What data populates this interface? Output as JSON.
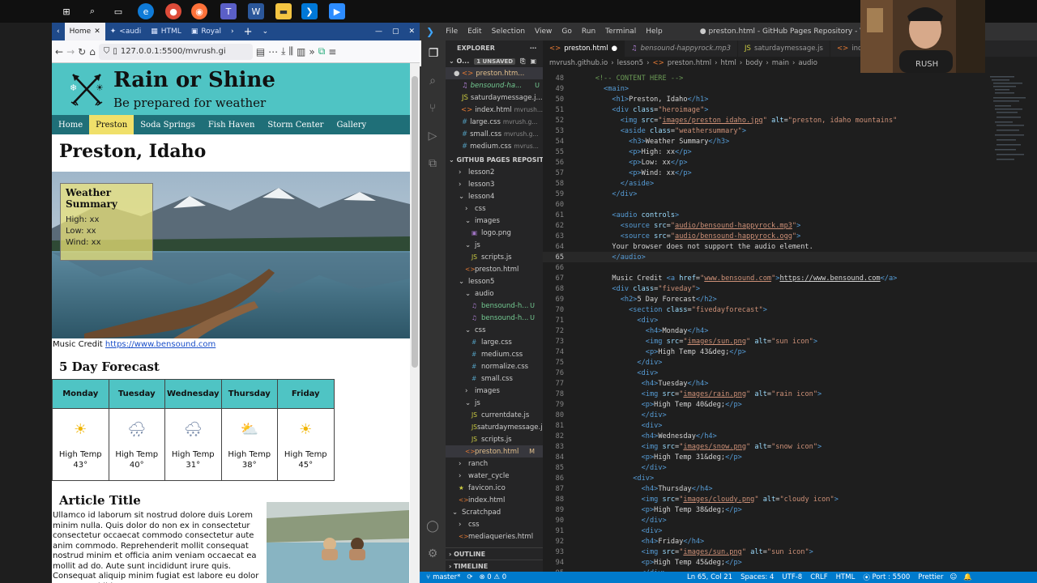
{
  "taskbar": {
    "icons": [
      "windows-icon",
      "search-icon",
      "task-view-icon",
      "edge-icon",
      "chrome-icon",
      "firefox-icon",
      "teams-icon",
      "word-icon",
      "file-explorer-icon",
      "vscode-icon",
      "zoom-icon"
    ]
  },
  "browser": {
    "tabs": [
      {
        "label": "Home",
        "active": true
      },
      {
        "label": "<audi"
      },
      {
        "label": "HTML"
      },
      {
        "label": "Royal"
      }
    ],
    "url": "127.0.0.1:5500/mvrush.gi",
    "page": {
      "site_title": "Rain or Shine",
      "tagline": "Be prepared for weather",
      "nav": [
        "Home",
        "Preston",
        "Soda Springs",
        "Fish Haven",
        "Storm Center",
        "Gallery"
      ],
      "active_nav": "Preston",
      "h1": "Preston, Idaho",
      "weather_summary": {
        "title": "Weather Summary",
        "high": "High: xx",
        "low": "Low: xx",
        "wind": "Wind: xx"
      },
      "credit_label": "Music Credit",
      "credit_link": "https://www.bensound.com",
      "forecast_title": "5 Day Forecast",
      "forecast": [
        {
          "day": "Monday",
          "icon": "sun-icon",
          "glyph": "☀",
          "temp": "High Temp 43°"
        },
        {
          "day": "Tuesday",
          "icon": "rain-icon",
          "glyph": "🌧",
          "temp": "High Temp 40°"
        },
        {
          "day": "Wednesday",
          "icon": "snow-icon",
          "glyph": "🌨",
          "temp": "High Temp 31°"
        },
        {
          "day": "Thursday",
          "icon": "cloudy-icon",
          "glyph": "⛅",
          "temp": "High Temp 38°"
        },
        {
          "day": "Friday",
          "icon": "sun-icon",
          "glyph": "☀",
          "temp": "High Temp 45°"
        }
      ],
      "article_title": "Article Title",
      "article_text": "Ullamco id laborum sit nostrud dolore duis Lorem minim nulla. Quis dolor do non ex in consectetur consectetur occaecat commodo consectetur aute anim commodo. Reprehenderit mollit consequat nostrud minim et officia anim veniam occaecat ea mollit ad do. Aute sunt incididunt irure quis. Consequat aliquip minim fugiat est labore eu dolor magna. Incididunt"
    }
  },
  "vscode": {
    "menu": [
      "File",
      "Edit",
      "Selection",
      "View",
      "Go",
      "Run",
      "Terminal",
      "Help"
    ],
    "window_title": "● preston.html - GitHub Pages Repository - Visual Studio Coc",
    "explorer_label": "EXPLORER",
    "open_editors_label": "O...",
    "unsaved_badge": "1 UNSAVED",
    "open_editors": [
      {
        "name": "preston.htm...",
        "dirty": true
      },
      {
        "name": "bensound-ha...",
        "badge": "U"
      },
      {
        "name": "saturdaymessage.j..."
      },
      {
        "name": "index.html",
        "path": "mvrush..."
      },
      {
        "name": "large.css",
        "path": "mvrush.g..."
      },
      {
        "name": "small.css",
        "path": "mvrush.g..."
      },
      {
        "name": "medium.css",
        "path": "mvrus..."
      }
    ],
    "repo_label": "GITHUB PAGES REPOSITORY",
    "tree": [
      {
        "name": "lesson2",
        "indent": 1,
        "type": "folder"
      },
      {
        "name": "lesson3",
        "indent": 1,
        "type": "folder"
      },
      {
        "name": "lesson4",
        "indent": 1,
        "type": "folder-open"
      },
      {
        "name": "css",
        "indent": 2,
        "type": "folder"
      },
      {
        "name": "images",
        "indent": 2,
        "type": "folder-open"
      },
      {
        "name": "logo.png",
        "indent": 3,
        "type": "file"
      },
      {
        "name": "js",
        "indent": 2,
        "type": "folder-open"
      },
      {
        "name": "scripts.js",
        "indent": 3,
        "type": "file"
      },
      {
        "name": "preston.html",
        "indent": 2,
        "type": "file"
      },
      {
        "name": "lesson5",
        "indent": 1,
        "type": "folder-open"
      },
      {
        "name": "audio",
        "indent": 2,
        "type": "folder-open"
      },
      {
        "name": "bensound-h...",
        "indent": 3,
        "type": "file",
        "badge": "U"
      },
      {
        "name": "bensound-h...",
        "indent": 3,
        "type": "file",
        "badge": "U"
      },
      {
        "name": "css",
        "indent": 2,
        "type": "folder-open"
      },
      {
        "name": "large.css",
        "indent": 3,
        "type": "file"
      },
      {
        "name": "medium.css",
        "indent": 3,
        "type": "file"
      },
      {
        "name": "normalize.css",
        "indent": 3,
        "type": "file"
      },
      {
        "name": "small.css",
        "indent": 3,
        "type": "file"
      },
      {
        "name": "images",
        "indent": 2,
        "type": "folder"
      },
      {
        "name": "js",
        "indent": 2,
        "type": "folder-open"
      },
      {
        "name": "currentdate.js",
        "indent": 3,
        "type": "file"
      },
      {
        "name": "saturdaymessage.js",
        "indent": 3,
        "type": "file"
      },
      {
        "name": "scripts.js",
        "indent": 3,
        "type": "file"
      },
      {
        "name": "preston.html",
        "indent": 2,
        "type": "file",
        "badge": "M",
        "selected": true
      },
      {
        "name": "ranch",
        "indent": 1,
        "type": "folder"
      },
      {
        "name": "water_cycle",
        "indent": 1,
        "type": "folder"
      },
      {
        "name": "favicon.ico",
        "indent": 1,
        "type": "file"
      },
      {
        "name": "index.html",
        "indent": 1,
        "type": "file"
      },
      {
        "name": "Scratchpad",
        "indent": 0,
        "type": "folder-open"
      },
      {
        "name": "css",
        "indent": 1,
        "type": "folder"
      },
      {
        "name": "mediaqueries.html",
        "indent": 1,
        "type": "file"
      }
    ],
    "outline_label": "OUTLINE",
    "timeline_label": "TIMELINE",
    "tabs": [
      {
        "label": "preston.html",
        "active": true,
        "dirty": true
      },
      {
        "label": "bensound-happyrock.mp3"
      },
      {
        "label": "saturdaymessage.js"
      },
      {
        "label": "index"
      }
    ],
    "breadcrumb": [
      "mvrush.github.io",
      "lesson5",
      "preston.html",
      "html",
      "body",
      "main",
      "audio"
    ],
    "code_lines": [
      {
        "n": "48",
        "html": "<span class='cm'>    &lt;!-- CONTENT HERE --&gt;</span>"
      },
      {
        "n": "49",
        "html": "<span class='tg'>      &lt;main&gt;</span>"
      },
      {
        "n": "50",
        "html": "<span class='tg'>        &lt;h1&gt;</span><span class='tx'>Preston, Idaho</span><span class='tg'>&lt;/h1&gt;</span>"
      },
      {
        "n": "51",
        "html": "<span class='tg'>        &lt;div </span><span class='at'>class</span><span class='tx'>=</span><span class='st'>\"heroimage\"</span><span class='tg'>&gt;</span>"
      },
      {
        "n": "52",
        "html": "<span class='tg'>          &lt;img </span><span class='at'>src</span><span class='tx'>=</span><span class='st'>\"<span class='ul'>images/preston_idaho.jpg</span>\"</span><span class='at'> alt</span><span class='tx'>=</span><span class='st'>\"preston, idaho mountains\"</span>"
      },
      {
        "n": "53",
        "html": "<span class='tg'>          &lt;aside </span><span class='at'>class</span><span class='tx'>=</span><span class='st'>\"weathersummary\"</span><span class='tg'>&gt;</span>"
      },
      {
        "n": "54",
        "html": "<span class='tg'>            &lt;h3&gt;</span><span class='tx'>Weather Summary</span><span class='tg'>&lt;/h3&gt;</span>"
      },
      {
        "n": "55",
        "html": "<span class='tg'>            &lt;p&gt;</span><span class='tx'>High: xx</span><span class='tg'>&lt;/p&gt;</span>"
      },
      {
        "n": "56",
        "html": "<span class='tg'>            &lt;p&gt;</span><span class='tx'>Low: xx</span><span class='tg'>&lt;/p&gt;</span>"
      },
      {
        "n": "57",
        "html": "<span class='tg'>            &lt;p&gt;</span><span class='tx'>Wind: xx</span><span class='tg'>&lt;/p&gt;</span>"
      },
      {
        "n": "58",
        "html": "<span class='tg'>          &lt;/aside&gt;</span>"
      },
      {
        "n": "59",
        "html": "<span class='tg'>        &lt;/div&gt;</span>"
      },
      {
        "n": "60",
        "html": ""
      },
      {
        "n": "61",
        "html": "<span class='tg'>        &lt;audio </span><span class='at'>controls</span><span class='tg'>&gt;</span>"
      },
      {
        "n": "62",
        "html": "<span class='tg'>          &lt;source </span><span class='at'>src</span><span class='tx'>=</span><span class='st'>\"<span class='ul'>audio/bensound-happyrock.mp3</span>\"</span><span class='tg'>&gt;</span>"
      },
      {
        "n": "63",
        "html": "<span class='tg'>          &lt;source </span><span class='at'>src</span><span class='tx'>=</span><span class='st'>\"<span class='ul'>audio/bensound-happyrock.ogg</span>\"</span><span class='tg'>&gt;</span>"
      },
      {
        "n": "64",
        "html": "<span class='tx'>        Your browser does not support the audio element.</span>"
      },
      {
        "n": "65",
        "html": "<span class='tg'>        &lt;/audio&gt;</span>",
        "cur": true
      },
      {
        "n": "66",
        "html": ""
      },
      {
        "n": "67",
        "html": "<span class='tx'>        Music Credit </span><span class='tg'>&lt;a </span><span class='at'>href</span><span class='tx'>=</span><span class='st'>\"<span class='ul'>www.bensound.com</span>\"</span><span class='tg'>&gt;</span><span class='tx ul'>https://www.bensound.com</span><span class='tg'>&lt;/a&gt;</span>"
      },
      {
        "n": "68",
        "html": "<span class='tg'>        &lt;div </span><span class='at'>class</span><span class='tx'>=</span><span class='st'>\"fiveday\"</span><span class='tg'>&gt;</span>"
      },
      {
        "n": "69",
        "html": "<span class='tg'>          &lt;h2&gt;</span><span class='tx'>5 Day Forecast</span><span class='tg'>&lt;/h2&gt;</span>"
      },
      {
        "n": "70",
        "html": "<span class='tg'>            &lt;section </span><span class='at'>class</span><span class='tx'>=</span><span class='st'>\"fivedayforecast\"</span><span class='tg'>&gt;</span>"
      },
      {
        "n": "71",
        "html": "<span class='tg'>              &lt;div&gt;</span>"
      },
      {
        "n": "72",
        "html": "<span class='tg'>                &lt;h4&gt;</span><span class='tx'>Monday</span><span class='tg'>&lt;/h4&gt;</span>"
      },
      {
        "n": "73",
        "html": "<span class='tg'>                &lt;img </span><span class='at'>src</span><span class='tx'>=</span><span class='st'>\"<span class='ul'>images/sun.png</span>\"</span><span class='at'> alt</span><span class='tx'>=</span><span class='st'>\"sun icon\"</span><span class='tg'>&gt;</span>"
      },
      {
        "n": "74",
        "html": "<span class='tg'>                &lt;p&gt;</span><span class='tx'>High Temp 43</span><span class='en'>&amp;deg;</span><span class='tg'>&lt;/p&gt;</span>"
      },
      {
        "n": "75",
        "html": "<span class='tg'>              &lt;/div&gt;</span>"
      },
      {
        "n": "76",
        "html": "<span class='tg'>              &lt;div&gt;</span>"
      },
      {
        "n": "77",
        "html": "<span class='tg'>               &lt;h4&gt;</span><span class='tx'>Tuesday</span><span class='tg'>&lt;/h4&gt;</span>"
      },
      {
        "n": "78",
        "html": "<span class='tg'>               &lt;img </span><span class='at'>src</span><span class='tx'>=</span><span class='st'>\"<span class='ul'>images/rain.png</span>\"</span><span class='at'> alt</span><span class='tx'>=</span><span class='st'>\"rain icon\"</span><span class='tg'>&gt;</span>"
      },
      {
        "n": "79",
        "html": "<span class='tg'>               &lt;p&gt;</span><span class='tx'>High Temp 40</span><span class='en'>&amp;deg;</span><span class='tg'>&lt;/p&gt;</span>"
      },
      {
        "n": "80",
        "html": "<span class='tg'>               &lt;/div&gt;</span>"
      },
      {
        "n": "81",
        "html": "<span class='tg'>               &lt;div&gt;</span>"
      },
      {
        "n": "82",
        "html": "<span class='tg'>               &lt;h4&gt;</span><span class='tx'>Wednesday</span><span class='tg'>&lt;/h4&gt;</span>"
      },
      {
        "n": "83",
        "html": "<span class='tg'>               &lt;img </span><span class='at'>src</span><span class='tx'>=</span><span class='st'>\"<span class='ul'>images/snow.png</span>\"</span><span class='at'> alt</span><span class='tx'>=</span><span class='st'>\"snow icon\"</span><span class='tg'>&gt;</span>"
      },
      {
        "n": "84",
        "html": "<span class='tg'>               &lt;p&gt;</span><span class='tx'>High Temp 31</span><span class='en'>&amp;deg;</span><span class='tg'>&lt;/p&gt;</span>"
      },
      {
        "n": "85",
        "html": "<span class='tg'>               &lt;/div&gt;</span>"
      },
      {
        "n": "86",
        "html": "<span class='tg'>             &lt;div&gt;</span>"
      },
      {
        "n": "87",
        "html": "<span class='tg'>               &lt;h4&gt;</span><span class='tx'>Thursday</span><span class='tg'>&lt;/h4&gt;</span>"
      },
      {
        "n": "88",
        "html": "<span class='tg'>               &lt;img </span><span class='at'>src</span><span class='tx'>=</span><span class='st'>\"<span class='ul'>images/cloudy.png</span>\"</span><span class='at'> alt</span><span class='tx'>=</span><span class='st'>\"cloudy icon\"</span><span class='tg'>&gt;</span>"
      },
      {
        "n": "89",
        "html": "<span class='tg'>               &lt;p&gt;</span><span class='tx'>High Temp 38</span><span class='en'>&amp;deg;</span><span class='tg'>&lt;/p&gt;</span>"
      },
      {
        "n": "90",
        "html": "<span class='tg'>               &lt;/div&gt;</span>"
      },
      {
        "n": "91",
        "html": "<span class='tg'>               &lt;div&gt;</span>"
      },
      {
        "n": "92",
        "html": "<span class='tg'>               &lt;h4&gt;</span><span class='tx'>Friday</span><span class='tg'>&lt;/h4&gt;</span>"
      },
      {
        "n": "93",
        "html": "<span class='tg'>               &lt;img </span><span class='at'>src</span><span class='tx'>=</span><span class='st'>\"<span class='ul'>images/sun.png</span>\"</span><span class='at'> alt</span><span class='tx'>=</span><span class='st'>\"sun icon\"</span><span class='tg'>&gt;</span>"
      },
      {
        "n": "94",
        "html": "<span class='tg'>               &lt;p&gt;</span><span class='tx'>High Temp 45</span><span class='en'>&amp;deg;</span><span class='tg'>&lt;/p&gt;</span>"
      },
      {
        "n": "95",
        "html": "<span class='tg'>               &lt;/div&gt;</span>"
      }
    ],
    "status": {
      "branch": "master*",
      "sync": "⟳",
      "problems": "⊗ 0 ⚠ 0",
      "position": "Ln 65, Col 21",
      "spaces": "Spaces: 4",
      "encoding": "UTF-8",
      "eol": "CRLF",
      "language": "HTML",
      "port": "Port : 5500",
      "formatter": "Prettier"
    }
  }
}
